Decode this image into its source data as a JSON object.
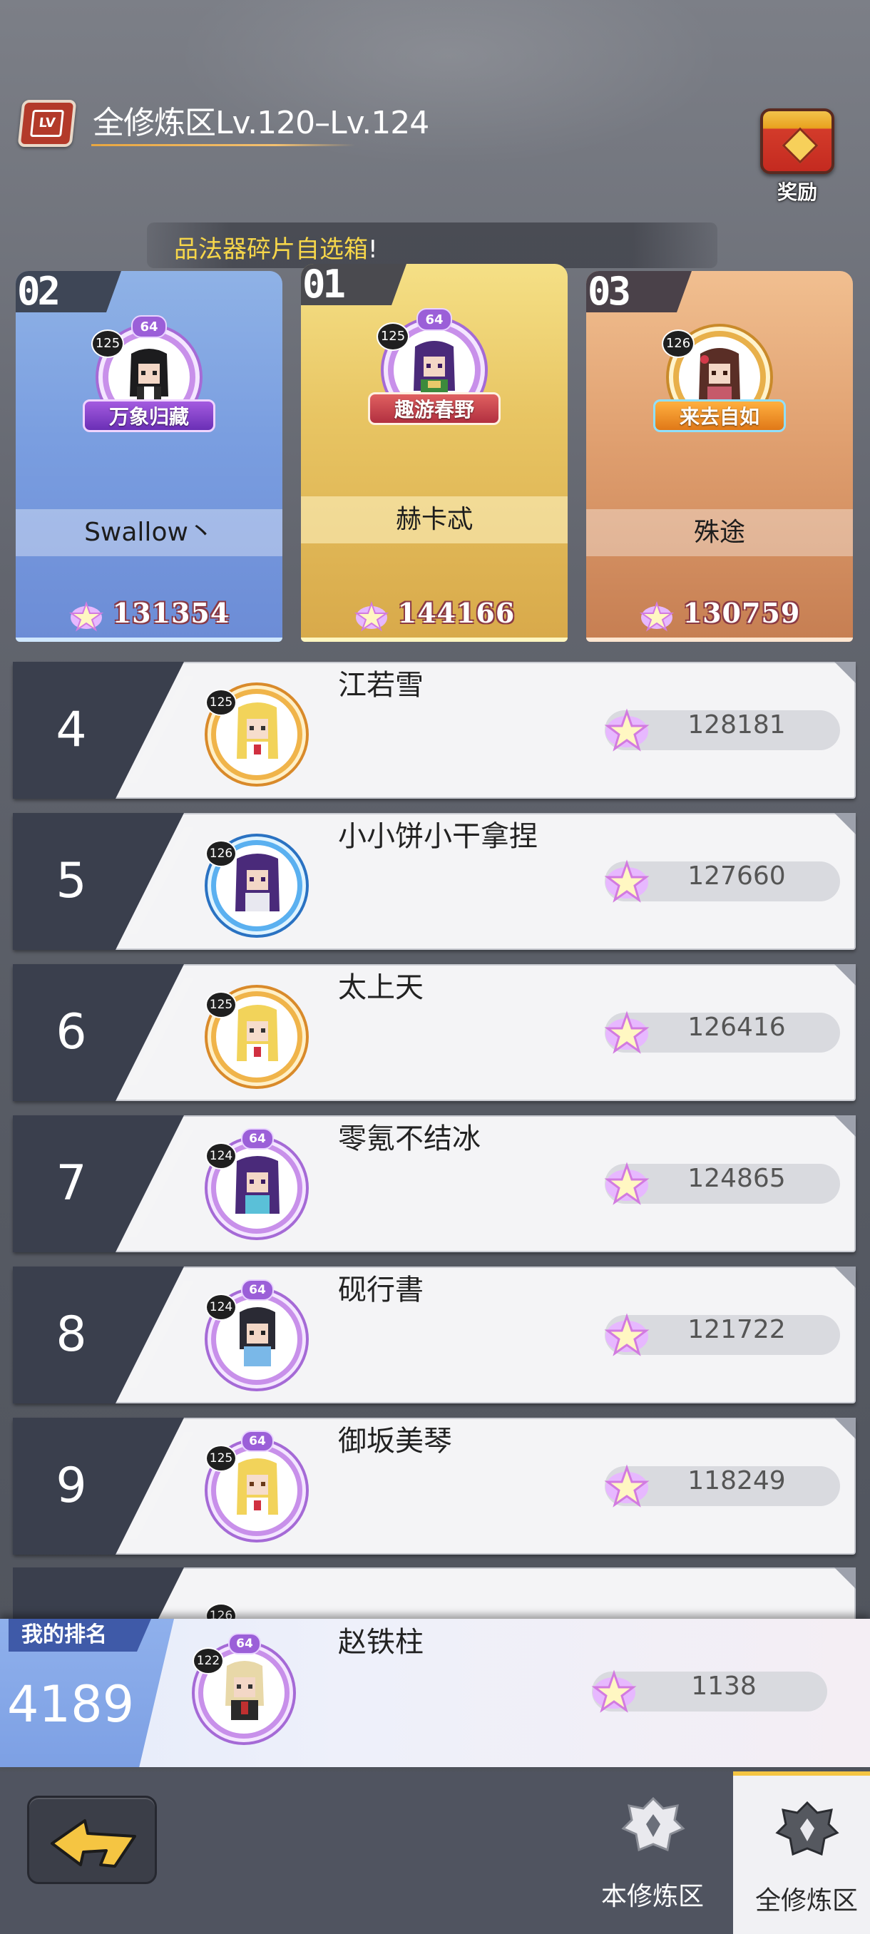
{
  "header": {
    "title": "全修炼区Lv.120–Lv.124",
    "reward_label": "奖励",
    "marquee_prefix": "品法器碎片自选箱",
    "marquee_suffix": "!"
  },
  "podium": [
    {
      "place": "02",
      "level": "125",
      "stars": "",
      "title_plaque": "万象归藏",
      "name": "Swallow丶",
      "score": "131354"
    },
    {
      "place": "01",
      "level": "125",
      "stars": "64",
      "title_plaque": "趣游春野",
      "name": "赫卡忒",
      "score": "144166"
    },
    {
      "place": "03",
      "level": "126",
      "stars": "",
      "title_plaque": "来去自如",
      "name": "殊途",
      "score": "130759"
    }
  ],
  "podium_stars_2": "64",
  "rows": [
    {
      "rank": "4",
      "level": "125",
      "stars": "",
      "name": "江若雪",
      "score": "128181"
    },
    {
      "rank": "5",
      "level": "126",
      "stars": "",
      "name": "小小饼小干拿捏",
      "score": "127660"
    },
    {
      "rank": "6",
      "level": "125",
      "stars": "",
      "name": "太上天",
      "score": "126416"
    },
    {
      "rank": "7",
      "level": "124",
      "stars": "64",
      "name": "零氪不结冰",
      "score": "124865"
    },
    {
      "rank": "8",
      "level": "124",
      "stars": "64",
      "name": "砚行書",
      "score": "121722"
    },
    {
      "rank": "9",
      "level": "125",
      "stars": "64",
      "name": "御坂美琴",
      "score": "118249"
    }
  ],
  "partial_row": {
    "level": "126"
  },
  "my_rank": {
    "tag": "我的排名",
    "rank": "4189",
    "level": "122",
    "stars": "64",
    "name": "赵铁柱",
    "score": "1138"
  },
  "tabs": [
    {
      "label": "本修炼区",
      "active": false
    },
    {
      "label": "全修炼区",
      "active": true
    }
  ],
  "colors": {
    "accent": "#f5c542",
    "podium_second": "#7a9ee0",
    "podium_first": "#e8c563",
    "podium_third": "#e0a070",
    "rank_cell": "#3a3f4d"
  }
}
